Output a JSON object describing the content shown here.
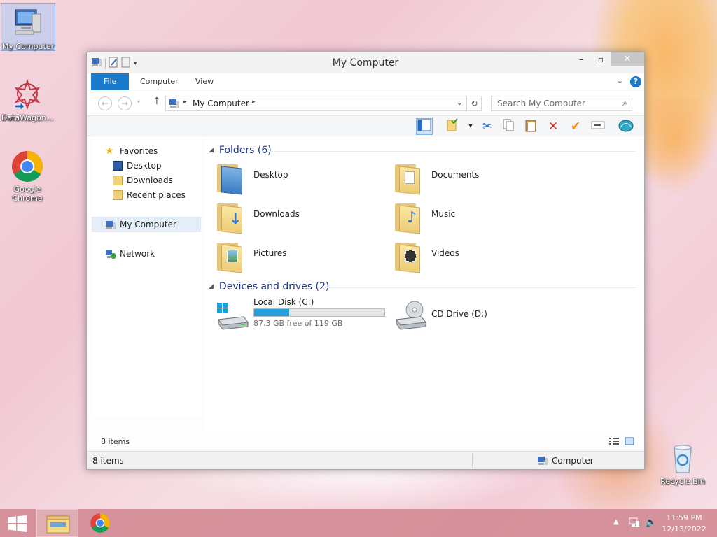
{
  "desktop": {
    "icons": [
      {
        "label": "My Computer"
      },
      {
        "label": "DataWagon..."
      },
      {
        "label": "Google Chrome"
      },
      {
        "label": "Recycle Bin"
      }
    ]
  },
  "window": {
    "title": "My Computer",
    "tabs": {
      "file": "File",
      "computer": "Computer",
      "view": "View"
    },
    "address": {
      "crumb": "My Computer"
    },
    "search": {
      "placeholder": "Search My Computer"
    },
    "nav": {
      "favorites": "Favorites",
      "desktop": "Desktop",
      "downloads": "Downloads",
      "recent": "Recent places",
      "computer": "My Computer",
      "network": "Network"
    },
    "folders_header": "Folders (6)",
    "folders": [
      {
        "name": "Desktop"
      },
      {
        "name": "Documents"
      },
      {
        "name": "Downloads"
      },
      {
        "name": "Music"
      },
      {
        "name": "Pictures"
      },
      {
        "name": "Videos"
      }
    ],
    "devices_header": "Devices and drives (2)",
    "drives": [
      {
        "name": "Local Disk (C:)",
        "free_text": "87.3 GB free of 119 GB",
        "used_fraction": 0.27
      },
      {
        "name": "CD Drive (D:)"
      }
    ],
    "items_count": "8 items",
    "status": {
      "left": "8 items",
      "right": "Computer"
    }
  },
  "taskbar": {
    "time": "11:59 PM",
    "date": "12/13/2022"
  },
  "colors": {
    "accent": "#1979ca",
    "drive_fill": "#26a0da",
    "group_header": "#1e3287"
  }
}
